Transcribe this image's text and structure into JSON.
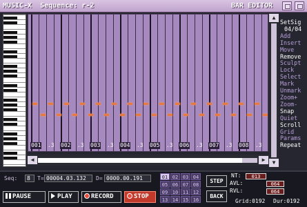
{
  "titlebar": {
    "app": "MUSIC-X",
    "sequence": "Sequence: r-2",
    "editor": "BAR EDITOR"
  },
  "menu": {
    "setsig_label": "SetSig",
    "setsig_value": "04/04",
    "items": [
      {
        "label": "Add",
        "bright": false
      },
      {
        "label": "Insert",
        "bright": false
      },
      {
        "label": "Move",
        "bright": false
      },
      {
        "label": "Remove",
        "bright": true
      },
      {
        "label": "Sculpt",
        "bright": false
      },
      {
        "label": "Lock",
        "bright": false
      },
      {
        "label": "Select",
        "bright": false
      },
      {
        "label": "Mark",
        "bright": false
      },
      {
        "label": "Unmark",
        "bright": false
      },
      {
        "label": "Zoom+",
        "bright": false
      },
      {
        "label": "Zoom-",
        "bright": false
      },
      {
        "label": "Snap",
        "bright": true
      },
      {
        "label": "Quiet",
        "bright": false
      },
      {
        "label": "Scroll",
        "bright": true
      },
      {
        "label": "Grid",
        "bright": false
      },
      {
        "label": "Params",
        "bright": false
      },
      {
        "label": "Repeat",
        "bright": true
      }
    ]
  },
  "bars": [
    {
      "bar": "001",
      "beat": ".3"
    },
    {
      "bar": "002",
      "beat": ".3"
    },
    {
      "bar": "003",
      "beat": ".3"
    },
    {
      "bar": "004",
      "beat": ".3"
    },
    {
      "bar": "005",
      "beat": ".3"
    },
    {
      "bar": "006",
      "beat": ".3"
    },
    {
      "bar": "007",
      "beat": ".3"
    },
    {
      "bar": "008",
      "beat": ".3"
    }
  ],
  "hscroll": {
    "position": 0.93
  },
  "status": {
    "seq_label": "Seq:",
    "seq_value": "8",
    "t_label": "T=",
    "t_value": "00004.03.132",
    "d_label": "D=",
    "d_value": "0000.00.191"
  },
  "transport": {
    "pause": "PAUSE",
    "play": "PLAY",
    "record": "RECORD",
    "stop": "STOP"
  },
  "tracks": {
    "cells": [
      "01",
      "02",
      "03",
      "04",
      "05",
      "06",
      "07",
      "08",
      "09",
      "10",
      "11",
      "12",
      "13",
      "14",
      "15",
      "16"
    ],
    "selected": "01"
  },
  "buttons": {
    "step": "STEP",
    "back": "BACK"
  },
  "params": {
    "nt_label": "NT:",
    "nt_value": "013",
    "avl1_label": "AVL:",
    "avl1_value": "064",
    "avl2_label": "RVL:",
    "avl2_value": "064",
    "grid_label": "Grid:",
    "grid_value": "0192",
    "dur_label": "Dur:",
    "dur_value": "0192"
  },
  "colors": {
    "grid_bg": "#a68abf",
    "note": "#e87a40",
    "stop": "#c0392b"
  }
}
